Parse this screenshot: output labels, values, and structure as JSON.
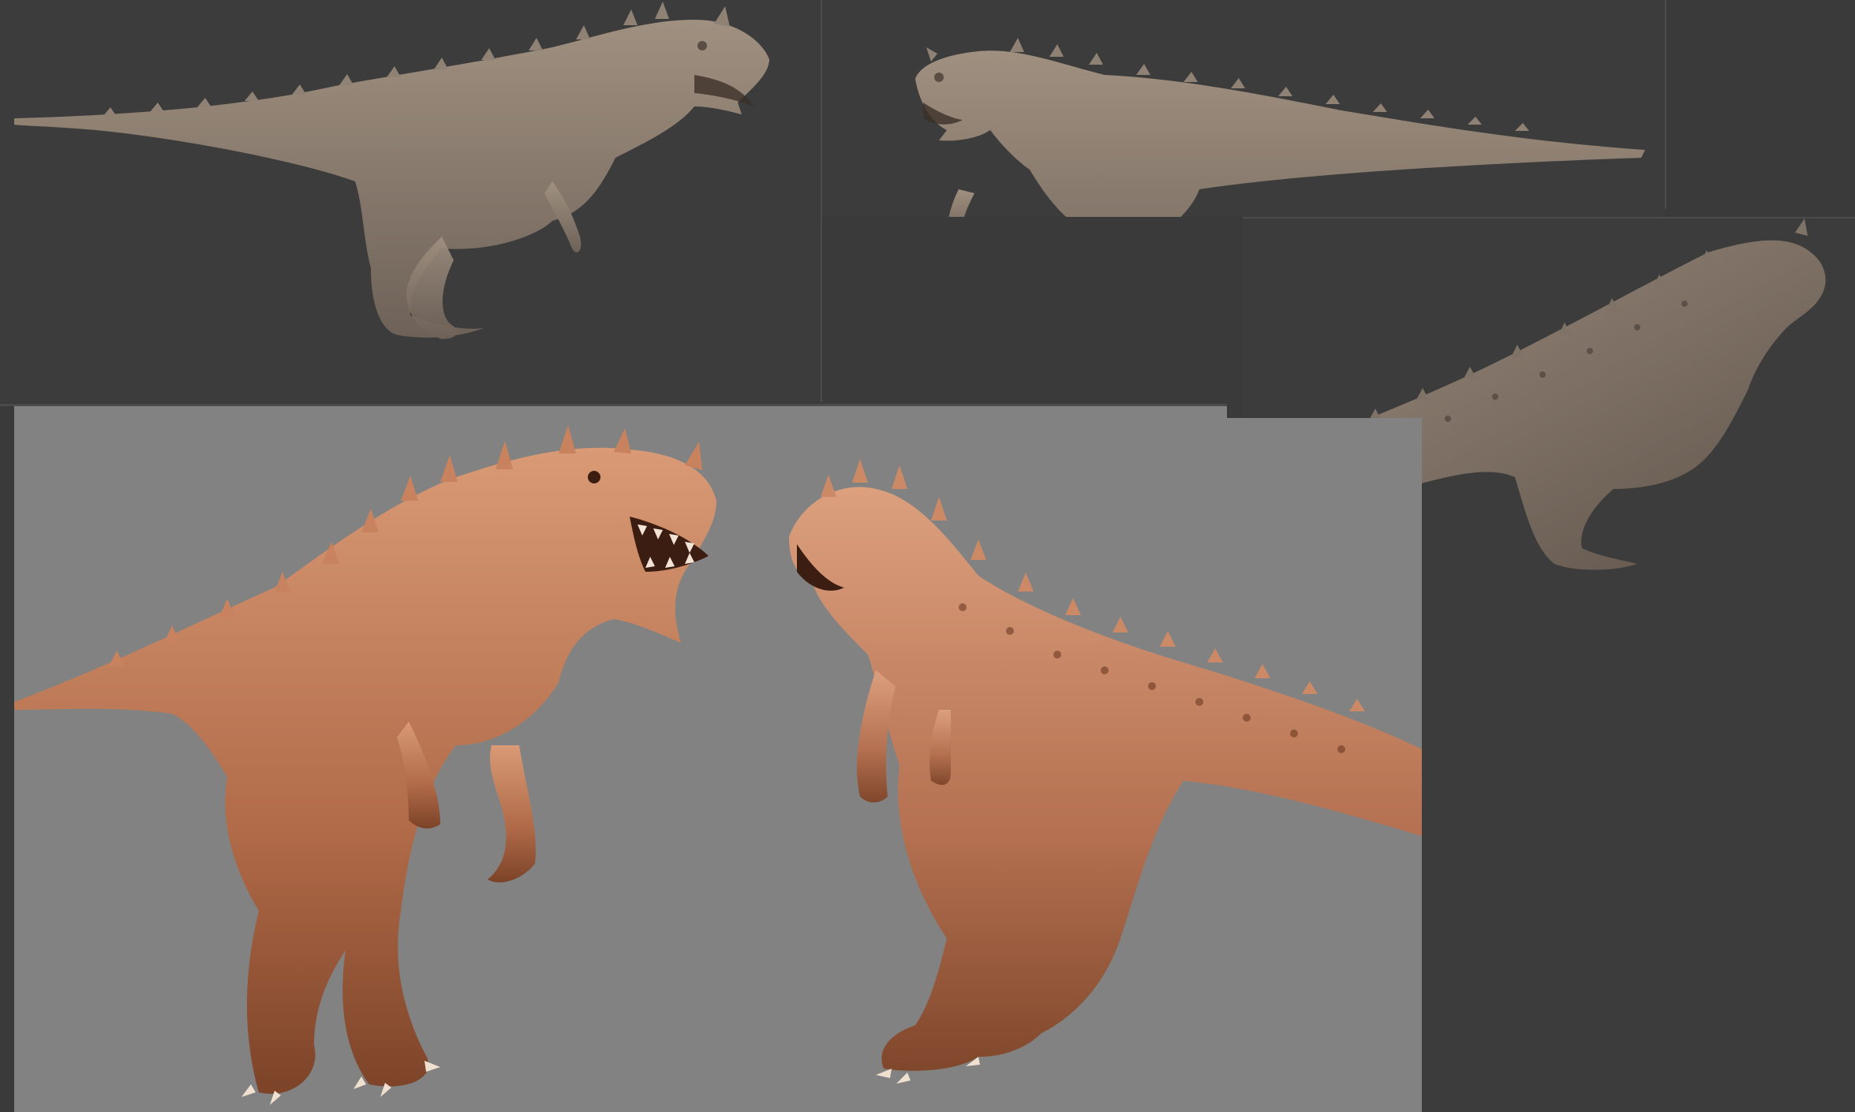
{
  "scene": {
    "background_color": "#3a3a3a",
    "viewport_dark_color": "#3c3c3c",
    "viewport_grey_color": "#828282",
    "matte_sculpt_color": "#8b7d70",
    "copper_sculpt_color": "#c07a58"
  },
  "views": [
    {
      "subject": "dinosaur-sculpt",
      "material": "matte-clay",
      "facing": "right",
      "view": "side"
    },
    {
      "subject": "dinosaur-sculpt",
      "material": "matte-clay",
      "facing": "left",
      "view": "side"
    },
    {
      "subject": "dinosaur-sculpt",
      "material": "matte-clay",
      "facing": "right",
      "view": "three-quarter-back"
    },
    {
      "subject": "dinosaur-sculpt",
      "material": "copper",
      "facing": "right",
      "view": "three-quarter-front"
    },
    {
      "subject": "dinosaur-sculpt",
      "material": "copper",
      "facing": "left",
      "view": "three-quarter-back"
    }
  ]
}
